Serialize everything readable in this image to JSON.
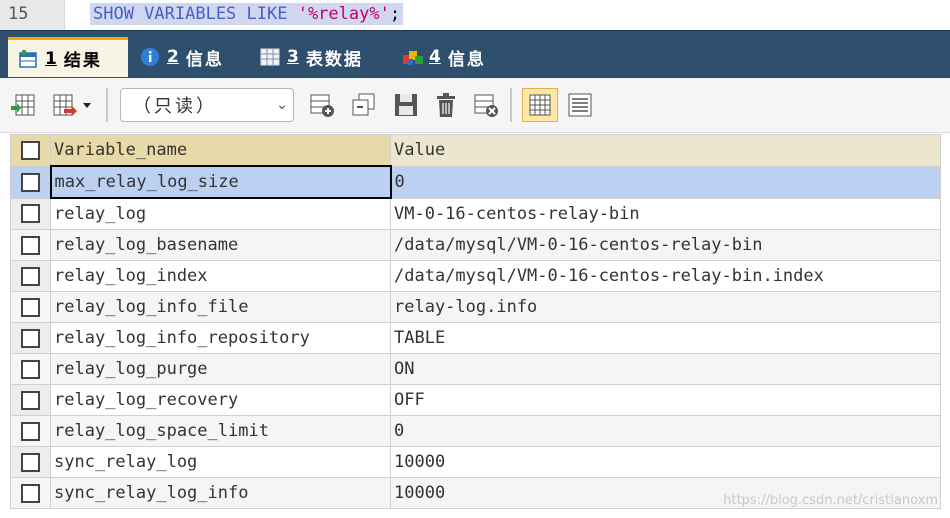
{
  "editor": {
    "line_number": "15",
    "sql_keyword": "SHOW VARIABLES LIKE ",
    "sql_string": "'%relay%'",
    "sql_end": ";"
  },
  "tabs": [
    {
      "num": "1",
      "label": "结果",
      "icon": "result-grid-icon"
    },
    {
      "num": "2",
      "label": "信息",
      "icon": "info-icon"
    },
    {
      "num": "3",
      "label": "表数据",
      "icon": "table-data-icon"
    },
    {
      "num": "4",
      "label": "信息",
      "icon": "info-colored-icon"
    }
  ],
  "toolbar": {
    "mode_select": "（只读）"
  },
  "grid": {
    "columns": [
      "Variable_name",
      "Value"
    ],
    "rows": [
      {
        "name": "max_relay_log_size",
        "value": "0"
      },
      {
        "name": "relay_log",
        "value": "VM-0-16-centos-relay-bin"
      },
      {
        "name": "relay_log_basename",
        "value": "/data/mysql/VM-0-16-centos-relay-bin"
      },
      {
        "name": "relay_log_index",
        "value": "/data/mysql/VM-0-16-centos-relay-bin.index"
      },
      {
        "name": "relay_log_info_file",
        "value": "relay-log.info"
      },
      {
        "name": "relay_log_info_repository",
        "value": "TABLE"
      },
      {
        "name": "relay_log_purge",
        "value": "ON"
      },
      {
        "name": "relay_log_recovery",
        "value": "OFF"
      },
      {
        "name": "relay_log_space_limit",
        "value": "0"
      },
      {
        "name": "sync_relay_log",
        "value": "10000"
      },
      {
        "name": "sync_relay_log_info",
        "value": "10000"
      }
    ]
  },
  "watermark": "https://blog.csdn.net/cristianoxm"
}
